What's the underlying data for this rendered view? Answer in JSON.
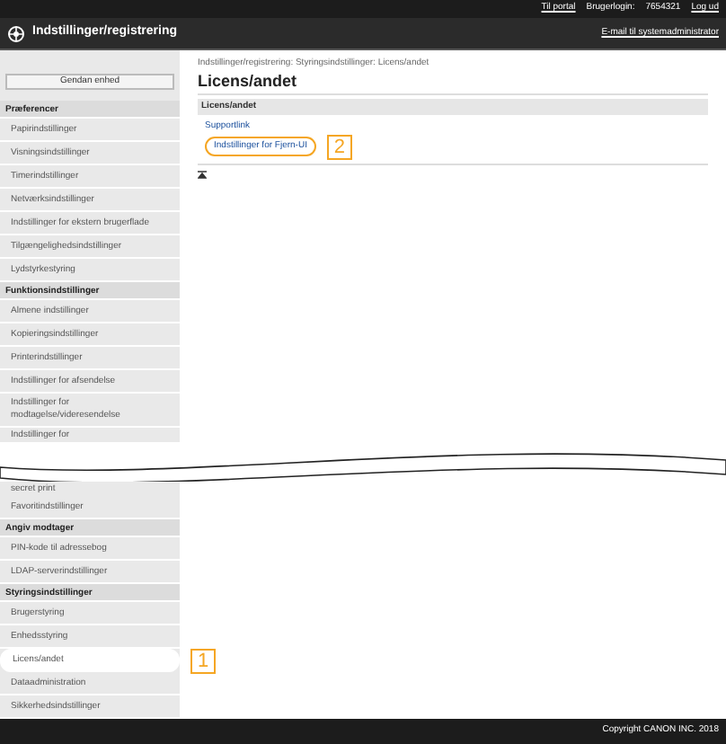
{
  "top_bar": {
    "portal_link": "Til portal",
    "login_label": "Brugerlogin:",
    "login_id": "7654321",
    "logout_link": "Log ud"
  },
  "header": {
    "title": "Indstillinger/registrering",
    "mail_link": "E-mail til systemadministrator"
  },
  "sidebar_upper": [
    {
      "kind": "button",
      "label": "Gendan enhed"
    },
    {
      "kind": "heading",
      "label": "Præferencer"
    },
    {
      "kind": "item",
      "label": "Papirindstillinger"
    },
    {
      "kind": "item",
      "label": "Visningsindstillinger"
    },
    {
      "kind": "item",
      "label": "Timerindstillinger"
    },
    {
      "kind": "item",
      "label": "Netværksindstillinger"
    },
    {
      "kind": "item",
      "label": "Indstillinger for ekstern brugerflade"
    },
    {
      "kind": "item",
      "label": "Tilgængelighedsindstillinger"
    },
    {
      "kind": "item",
      "label": "Lydstyrkestyring"
    },
    {
      "kind": "heading",
      "label": "Funktionsindstillinger"
    },
    {
      "kind": "item",
      "label": "Almene indstillinger"
    },
    {
      "kind": "item",
      "label": "Kopieringsindstillinger"
    },
    {
      "kind": "item",
      "label": "Printerindstillinger"
    },
    {
      "kind": "item",
      "label": "Indstillinger for afsendelse"
    },
    {
      "kind": "item",
      "label": "Indstillinger for modtagelse/videresendelse"
    },
    {
      "kind": "partial",
      "label": "Indstillinger for"
    }
  ],
  "sidebar_lower": [
    {
      "kind": "partial",
      "label": "secret print"
    },
    {
      "kind": "item",
      "label": "Favoritindstillinger"
    },
    {
      "kind": "heading",
      "label": "Angiv modtager"
    },
    {
      "kind": "item",
      "label": "PIN-kode til adressebog"
    },
    {
      "kind": "item",
      "label": "LDAP-serverindstillinger"
    },
    {
      "kind": "heading",
      "label": "Styringsindstillinger"
    },
    {
      "kind": "item",
      "label": "Brugerstyring"
    },
    {
      "kind": "item",
      "label": "Enhedsstyring"
    },
    {
      "kind": "item",
      "label": "Licens/andet",
      "callout": "1"
    },
    {
      "kind": "item",
      "label": "Dataadministration"
    },
    {
      "kind": "item",
      "label": "Sikkerhedsindstillinger"
    }
  ],
  "main": {
    "breadcrumb": "Indstillinger/registrering: Styringsindstillinger: Licens/andet",
    "title": "Licens/andet",
    "section": "Licens/andet",
    "links": [
      {
        "label": "Supportlink"
      },
      {
        "label": "Indstillinger for Fjern-UI",
        "callout": "2"
      }
    ]
  },
  "footer": {
    "copyright": "Copyright CANON INC. 2018"
  }
}
